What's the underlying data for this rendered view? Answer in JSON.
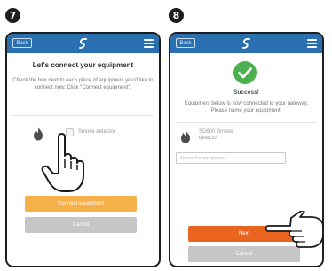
{
  "steps": [
    "7",
    "8"
  ],
  "screen1": {
    "back": "Back",
    "title": "Let's connect your equipment",
    "description": "Check the box next to each piece of equipment you'd like to connect now. Click \"Connect equipment\".",
    "device_label": "Smoke detector",
    "connect_button": "Connect equipment",
    "cancel_button": "Cancel"
  },
  "screen2": {
    "back": "Back",
    "success": "Success!",
    "description": "Equipment below is now connected to your gateway. Please name your equipment.",
    "device_name": "SD600 Smoke detector",
    "name_placeholder": "Name the equipment",
    "next_button": "Next",
    "cancel_button": "Cancel"
  },
  "colors": {
    "header": "#2a6fb0",
    "connect_button": "#f5b04a",
    "next_button": "#e9641f",
    "cancel_button": "#c6c6c6",
    "success": "#4caf50"
  },
  "icons": [
    "flame-icon",
    "logo-icon",
    "menu-icon",
    "success-check-icon",
    "pointing-hand-icon"
  ]
}
